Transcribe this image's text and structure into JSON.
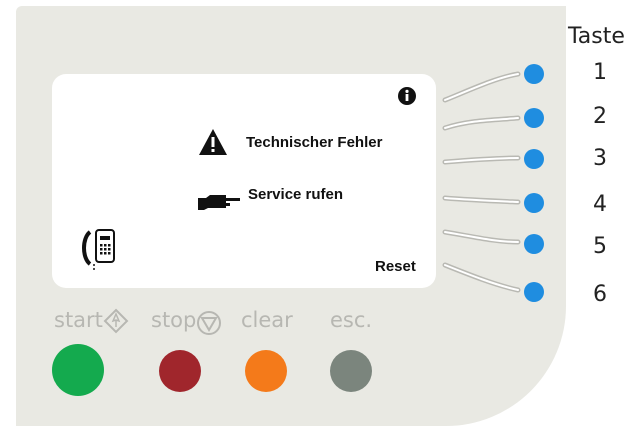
{
  "display": {
    "message_error": "Technischer Fehler",
    "message_action": "Service rufen",
    "reset_label": "Reset"
  },
  "keys": {
    "title": "Taste",
    "labels": [
      "1",
      "2",
      "3",
      "4",
      "5",
      "6"
    ]
  },
  "controls": {
    "start_label": "start",
    "stop_label": "stop",
    "clear_label": "clear",
    "esc_label": "esc."
  },
  "icons": {
    "info": "info-icon",
    "warning": "warning-triangle-icon",
    "pointing_hand": "pointing-hand-icon",
    "phone": "phone-icon",
    "start": "diamond-start-icon",
    "stop": "circle-stop-icon"
  },
  "colors": {
    "panel": "#e9e9e3",
    "display": "#ffffff",
    "key_blue": "#1f8de0",
    "start_green": "#14aa4e",
    "stop_red": "#a0262c",
    "clear_orange": "#f47a1a",
    "esc_gray": "#7b857d",
    "label_gray": "#b7b7b2"
  }
}
